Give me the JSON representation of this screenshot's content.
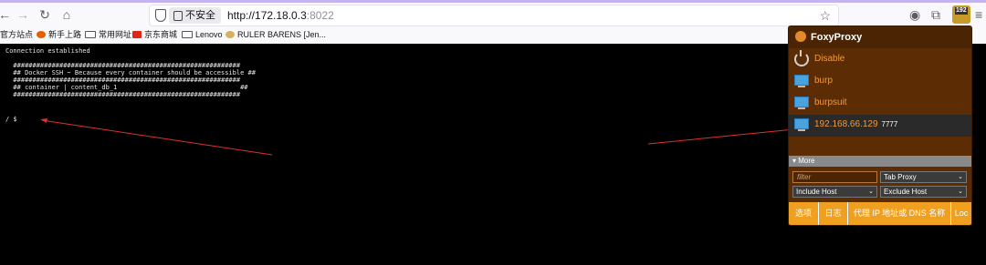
{
  "browser": {
    "security_label": "不安全",
    "url_host": "http://172.18.0.3",
    "url_port": ":8022",
    "extension_badge": "192",
    "bookmarks": [
      {
        "label": "官方站点",
        "icon": "none"
      },
      {
        "label": "新手上路",
        "icon": "firefox-icon"
      },
      {
        "label": "常用网址",
        "icon": "folder-icon"
      },
      {
        "label": "京东商城",
        "icon": "jd-icon"
      },
      {
        "label": "Lenovo",
        "icon": "folder-icon"
      },
      {
        "label": "RULER BARENS [Jen...",
        "icon": "jenkins-icon"
      }
    ]
  },
  "terminal": {
    "lines": [
      "Connection established",
      "",
      "  ###########################################################",
      "  ## Docker SSH ~ Because every container should be accessible ##",
      "  ###########################################################",
      "  ## container | content_db_1                                ##",
      "  ###########################################################",
      "",
      "",
      "/ $"
    ]
  },
  "foxyproxy": {
    "title": "FoxyProxy",
    "items": [
      {
        "label": "Disable",
        "port": "",
        "icon": "power-icon"
      },
      {
        "label": "burp",
        "port": "",
        "icon": "monitor-icon"
      },
      {
        "label": "burpsuit",
        "port": "",
        "icon": "monitor-icon"
      },
      {
        "label": "192.168.66.129",
        "port": "7777",
        "icon": "monitor-icon"
      }
    ],
    "more_label": "▾ More",
    "filter_placeholder": "filter",
    "select_tab_proxy": "Tab Proxy",
    "select_include_host": "Include Host",
    "select_exclude_host": "Exclude Host",
    "buttons": [
      "选项",
      "日志",
      "代理 IP 地址或 DNS 名称",
      "Loc"
    ]
  },
  "colors": {
    "popup_bg": "#5c2d05",
    "accent_orange": "#f29a38",
    "button_bar": "#f0a020",
    "annotation_arrow": "#e03030"
  }
}
